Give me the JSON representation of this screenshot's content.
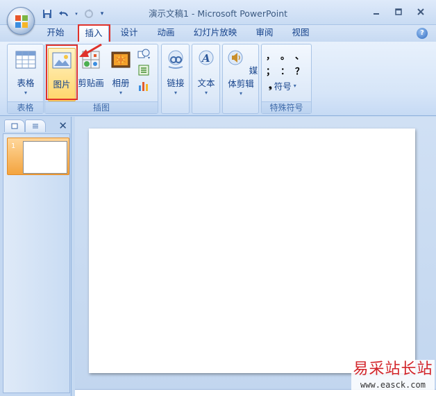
{
  "window": {
    "title": "演示文稿1 - Microsoft PowerPoint"
  },
  "qat": {
    "save": "save-icon",
    "undo": "undo-icon",
    "redo": "redo-icon",
    "customize": "customize-icon"
  },
  "tabs": [
    {
      "label": "开始"
    },
    {
      "label": "插入",
      "active": true
    },
    {
      "label": "设计"
    },
    {
      "label": "动画"
    },
    {
      "label": "幻灯片放映"
    },
    {
      "label": "审阅"
    },
    {
      "label": "视图"
    }
  ],
  "ribbon": {
    "groups": {
      "tables": {
        "label": "表格",
        "table_button": "表格"
      },
      "illustrations": {
        "label": "插图",
        "picture_button": "图片",
        "clipart_button": "剪贴画",
        "album_button": "相册"
      },
      "links": {
        "link_button": "链接"
      },
      "text": {
        "text_button": "文本"
      },
      "media": {
        "media_button": "媒体剪辑"
      },
      "symbols": {
        "label": "特殊符号",
        "symbol_button": "符号",
        "glyphs": [
          "，",
          "。",
          "、",
          "；",
          "：",
          "？"
        ]
      }
    }
  },
  "slides_panel": {
    "slide_number": "1"
  },
  "watermark": {
    "name": "易采站长站",
    "url": "www.easck.com"
  },
  "colors": {
    "highlight": "#e0312a",
    "selected_thumb": "#f3a43f"
  }
}
